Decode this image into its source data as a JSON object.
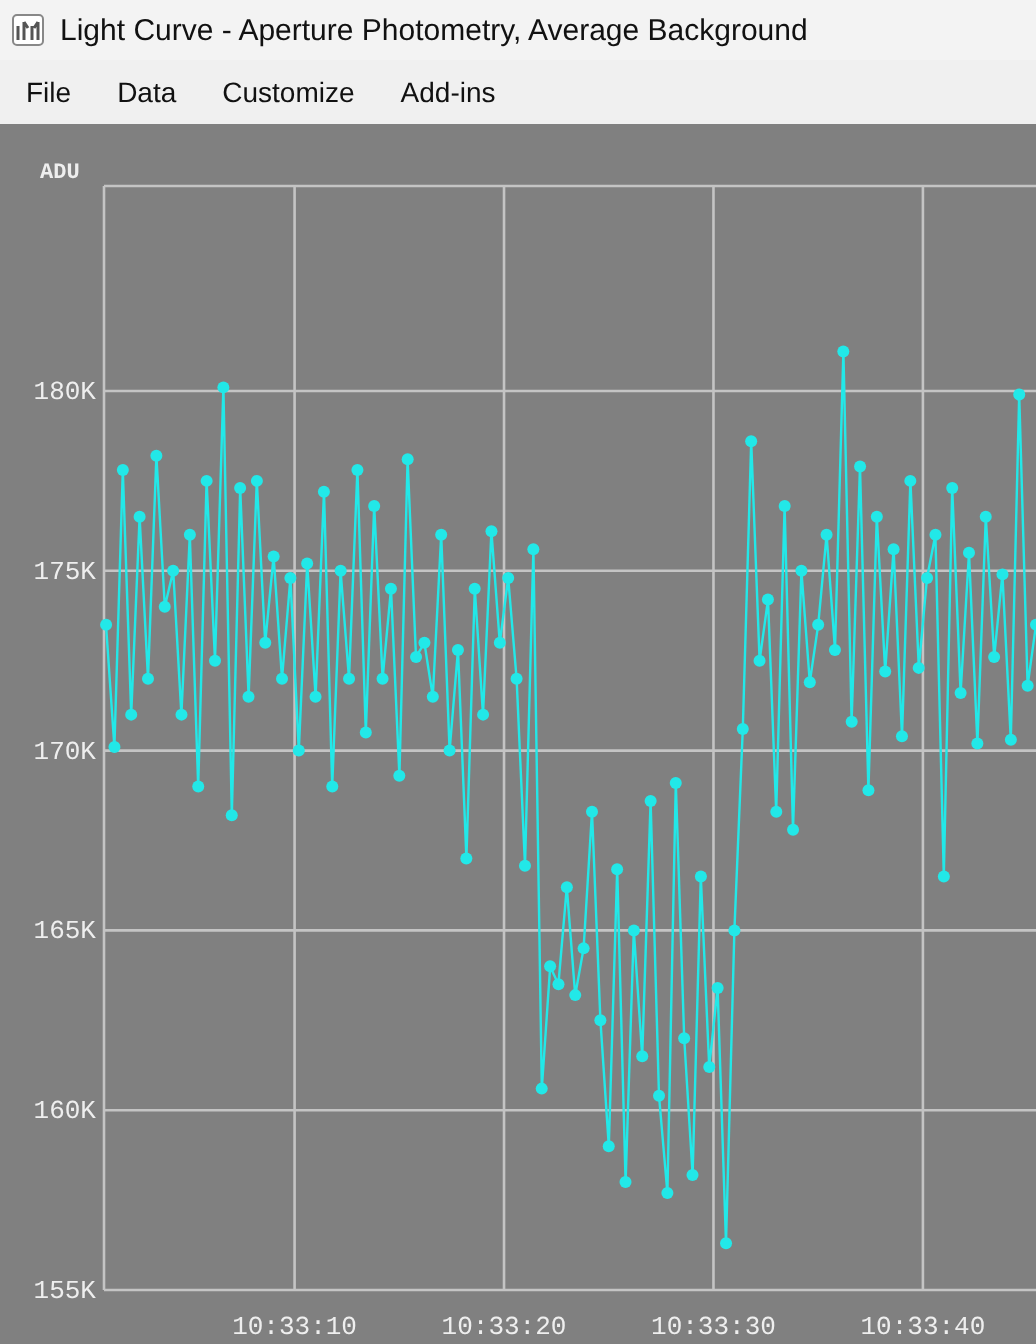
{
  "window": {
    "title": "Light Curve - Aperture Photometry, Average Background"
  },
  "menu": [
    "File",
    "Data",
    "Customize",
    "Add-ins"
  ],
  "plot": {
    "chart_data": {
      "type": "line",
      "ylabel": "ADU",
      "grid": true,
      "xlim": [
        37980.9,
        38025.4
      ],
      "ylim": [
        155,
        185.7
      ],
      "xticks": [
        {
          "value": 37990,
          "label": "10:33:10"
        },
        {
          "value": 38000,
          "label": "10:33:20"
        },
        {
          "value": 38010,
          "label": "10:33:30"
        },
        {
          "value": 38020,
          "label": "10:33:40"
        }
      ],
      "yticks": [
        {
          "value": 155,
          "label": "155K"
        },
        {
          "value": 160,
          "label": "160K"
        },
        {
          "value": 165,
          "label": "165K"
        },
        {
          "value": 170,
          "label": "170K"
        },
        {
          "value": 175,
          "label": "175K"
        },
        {
          "value": 180,
          "label": "180K"
        }
      ],
      "x": [
        37981,
        37981.4,
        37981.8,
        37982.2,
        37982.6,
        37983,
        37983.4,
        37983.8,
        37984.2,
        37984.6,
        37985,
        37985.4,
        37985.8,
        37986.2,
        37986.6,
        37987,
        37987.4,
        37987.8,
        37988.2,
        37988.6,
        37989,
        37989.4,
        37989.8,
        37990.2,
        37990.6,
        37991,
        37991.4,
        37991.8,
        37992.2,
        37992.6,
        37993,
        37993.4,
        37993.8,
        37994.2,
        37994.6,
        37995,
        37995.4,
        37995.8,
        37996.2,
        37996.6,
        37997,
        37997.4,
        37997.8,
        37998.2,
        37998.6,
        37999,
        37999.4,
        37999.8,
        38000.2,
        38000.6,
        38001,
        38001.4,
        38001.8,
        38002.2,
        38002.6,
        38003,
        38003.4,
        38003.8,
        38004.2,
        38004.6,
        38005,
        38005.4,
        38005.8,
        38006.2,
        38006.6,
        38007,
        38007.4,
        38007.8,
        38008.2,
        38008.6,
        38009,
        38009.4,
        38009.8,
        38010.2,
        38010.6,
        38011,
        38011.4,
        38011.8,
        38012.2,
        38012.6,
        38013,
        38013.4,
        38013.8,
        38014.2,
        38014.6,
        38015,
        38015.4,
        38015.8,
        38016.2,
        38016.6,
        38017,
        38017.4,
        38017.8,
        38018.2,
        38018.6,
        38019,
        38019.4,
        38019.8,
        38020.2,
        38020.6,
        38021,
        38021.4,
        38021.8,
        38022.2,
        38022.6,
        38023,
        38023.4,
        38023.8,
        38024.2,
        38024.6,
        38025,
        38025.4
      ],
      "series": [
        {
          "color": "#22e8e8",
          "marker": "circle",
          "values": [
            173.5,
            170.1,
            177.8,
            171,
            176.5,
            172,
            178.2,
            174,
            175,
            171,
            176,
            169,
            177.5,
            172.5,
            180.1,
            168.2,
            177.3,
            171.5,
            177.5,
            173,
            175.4,
            172,
            174.8,
            170,
            175.2,
            171.5,
            177.2,
            169,
            175,
            172,
            177.8,
            170.5,
            176.8,
            172,
            174.5,
            169.3,
            178.1,
            172.6,
            173,
            171.5,
            176,
            170,
            172.8,
            167,
            174.5,
            171,
            176.1,
            173,
            174.8,
            172,
            166.8,
            175.6,
            160.6,
            164,
            163.5,
            166.2,
            163.2,
            164.5,
            168.3,
            162.5,
            159,
            166.7,
            158,
            165,
            161.5,
            168.6,
            160.4,
            157.7,
            169.1,
            162,
            158.2,
            166.5,
            161.2,
            163.4,
            156.3,
            165,
            170.6,
            178.6,
            172.5,
            174.2,
            168.3,
            176.8,
            167.8,
            175,
            171.9,
            173.5,
            176,
            172.8,
            181.1,
            170.8,
            177.9,
            168.9,
            176.5,
            172.2,
            175.6,
            170.4,
            177.5,
            172.3,
            174.8,
            176,
            166.5,
            177.3,
            171.6,
            175.5,
            170.2,
            176.5,
            172.6,
            174.9,
            170.3,
            179.9,
            171.8,
            173.5
          ]
        }
      ]
    }
  }
}
